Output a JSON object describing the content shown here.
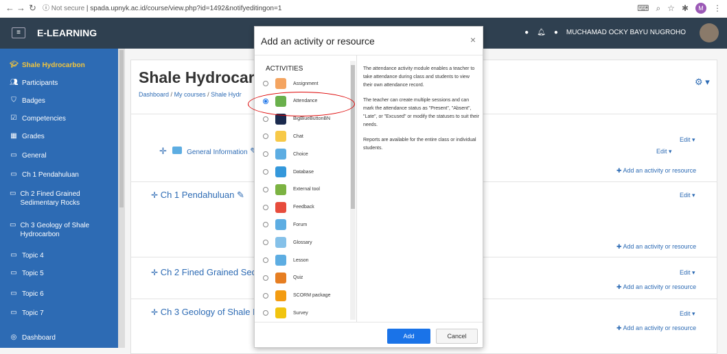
{
  "browser": {
    "not_secure": "Not secure",
    "url": "spada.upnyk.ac.id/course/view.php?id=1492&notifyeditingon=1",
    "profile_initial": "M"
  },
  "navbar": {
    "menu": "≡",
    "brand": "E-LEARNING",
    "user_name": "MUCHAMAD OCKY BAYU NUGROHO"
  },
  "sidebar": {
    "items": [
      {
        "label": "Shale Hydrocarbon",
        "icon": "graduation-cap-icon"
      },
      {
        "label": "Participants",
        "icon": "users-icon"
      },
      {
        "label": "Badges",
        "icon": "shield-icon"
      },
      {
        "label": "Competencies",
        "icon": "check-square-icon"
      },
      {
        "label": "Grades",
        "icon": "table-icon"
      },
      {
        "label": "General",
        "icon": "folder-icon"
      },
      {
        "label": "Ch 1 Pendahuluan",
        "icon": "folder-icon"
      },
      {
        "label": "Ch 2 Fined Grained Sedimentary Rocks",
        "icon": "folder-icon"
      },
      {
        "label": "Ch 3 Geology of Shale Hydrocarbon",
        "icon": "folder-icon"
      },
      {
        "label": "Topic 4",
        "icon": "folder-icon"
      },
      {
        "label": "Topic 5",
        "icon": "folder-icon"
      },
      {
        "label": "Topic 6",
        "icon": "folder-icon"
      },
      {
        "label": "Topic 7",
        "icon": "folder-icon"
      },
      {
        "label": "Dashboard",
        "icon": "dashboard-icon"
      }
    ]
  },
  "course": {
    "title": "Shale Hydrocarb",
    "breadcrumb": [
      "Dashboard",
      "My courses",
      "Shale Hydr"
    ],
    "sections": [
      {
        "title": "General Information",
        "edit": "Edit ▾",
        "edit2": "Edit ▾"
      },
      {
        "title": "Ch 1 Pendahuluan",
        "edit": "Edit ▾"
      },
      {
        "title": "Ch 2 Fined Grained Sedi",
        "edit": "Edit ▾"
      },
      {
        "title": "Ch 3 Geology of Shale H",
        "edit": "Edit ▾"
      }
    ],
    "add_activity": "Add an activity or resource"
  },
  "modal": {
    "title": "Add an activity or resource",
    "close": "×",
    "activities_header": "ACTIVITIES",
    "activities": [
      {
        "label": "Assignment",
        "color": "#f4a460",
        "selected": false
      },
      {
        "label": "Attendance",
        "color": "#6ab04c",
        "selected": true
      },
      {
        "label": "BigBlueButtonBN",
        "color": "#1b2a4e",
        "selected": false
      },
      {
        "label": "Chat",
        "color": "#f7c948",
        "selected": false
      },
      {
        "label": "Choice",
        "color": "#5dade2",
        "selected": false
      },
      {
        "label": "Database",
        "color": "#3498db",
        "selected": false
      },
      {
        "label": "External tool",
        "color": "#7cb342",
        "selected": false
      },
      {
        "label": "Feedback",
        "color": "#e74c3c",
        "selected": false
      },
      {
        "label": "Forum",
        "color": "#5dade2",
        "selected": false
      },
      {
        "label": "Glossary",
        "color": "#85c1e9",
        "selected": false
      },
      {
        "label": "Lesson",
        "color": "#5dade2",
        "selected": false
      },
      {
        "label": "Quiz",
        "color": "#e67e22",
        "selected": false
      },
      {
        "label": "SCORM package",
        "color": "#f39c12",
        "selected": false
      },
      {
        "label": "Survey",
        "color": "#f1c40f",
        "selected": false
      }
    ],
    "description": [
      "The attendance activity module enables a teacher to take attendance during class and students to view their own attendance record.",
      "The teacher can create multiple sessions and can mark the attendance status as \"Present\", \"Absent\", \"Late\", or \"Excused\" or modify the statuses to suit their needs.",
      "Reports are available for the entire class or individual students."
    ],
    "add_button": "Add",
    "cancel_button": "Cancel"
  }
}
